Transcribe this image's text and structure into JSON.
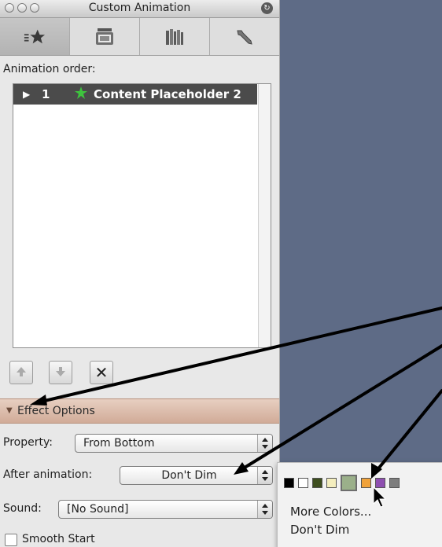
{
  "window": {
    "title": "Custom Animation"
  },
  "tabs": [
    {
      "name": "animation-tab",
      "icon": "star-list-icon",
      "active": true
    },
    {
      "name": "slide-transition-tab",
      "icon": "slide-icon",
      "active": false
    },
    {
      "name": "library-tab",
      "icon": "books-icon",
      "active": false
    },
    {
      "name": "settings-tab",
      "icon": "wrench-icon",
      "active": false
    }
  ],
  "animation_order": {
    "label": "Animation order:",
    "items": [
      {
        "toggle": "▶",
        "number": "1",
        "icon": "star-icon",
        "name": "Content Placeholder 2"
      }
    ]
  },
  "order_buttons": {
    "up_icon": "arrow-up-icon",
    "down_icon": "arrow-down-icon",
    "delete_label": "✕"
  },
  "effect_options": {
    "header": "Effect Options",
    "property_label": "Property:",
    "property_value": "From Bottom",
    "after_label": "After animation:",
    "after_value": "Don't Dim",
    "sound_label": "Sound:",
    "sound_value": "[No Sound]",
    "smooth_start_label": "Smooth Start",
    "smooth_start_checked": false
  },
  "color_menu": {
    "swatches": [
      "#000000",
      "#ffffff",
      "#3e4e1f",
      "#f4eebe",
      "#9bb08a",
      "#f0a23a",
      "#8e4fb0",
      "#7e7e7e"
    ],
    "highlighted_index": 4,
    "items": [
      "More Colors...",
      "Don't Dim"
    ]
  },
  "colors": {
    "slide_background": "#5e6b86",
    "section_header": "#d6b3a0",
    "selected_row": "#4b4b4b",
    "star_green": "#3ec43e"
  }
}
